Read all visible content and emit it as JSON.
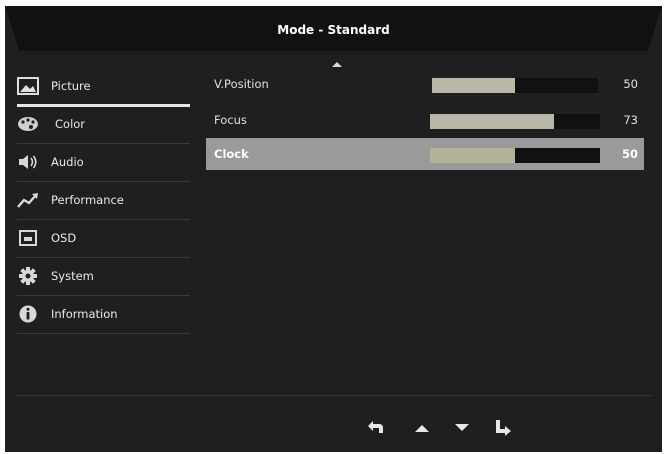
{
  "header": {
    "title": "Mode - Standard"
  },
  "sidebar": {
    "items": [
      {
        "label": "Picture",
        "icon": "picture-icon",
        "active": true
      },
      {
        "label": "Color",
        "icon": "palette-icon"
      },
      {
        "label": "Audio",
        "icon": "speaker-icon"
      },
      {
        "label": "Performance",
        "icon": "performance-chart-icon"
      },
      {
        "label": "OSD",
        "icon": "osd-window-icon"
      },
      {
        "label": "System",
        "icon": "gear-icon"
      },
      {
        "label": "Information",
        "icon": "info-icon"
      }
    ]
  },
  "settings": {
    "rows": [
      {
        "label": "V.Position",
        "value": "50",
        "level": 0.5
      },
      {
        "label": "Focus",
        "value": "73",
        "level": 0.73
      },
      {
        "label": "Clock",
        "value": "50",
        "level": 0.5,
        "selected": true
      }
    ]
  },
  "footer": {
    "buttons": [
      {
        "icon": "back-arrow-icon"
      },
      {
        "icon": "up-arrow-icon"
      },
      {
        "icon": "down-arrow-icon"
      },
      {
        "icon": "enter-arrow-icon"
      }
    ]
  },
  "colors": {
    "background": "#1f1f1f",
    "bar_fill": "#b9b7a5",
    "selected_row": "#9a9a9a",
    "accent_line": "#e6e6e6"
  }
}
